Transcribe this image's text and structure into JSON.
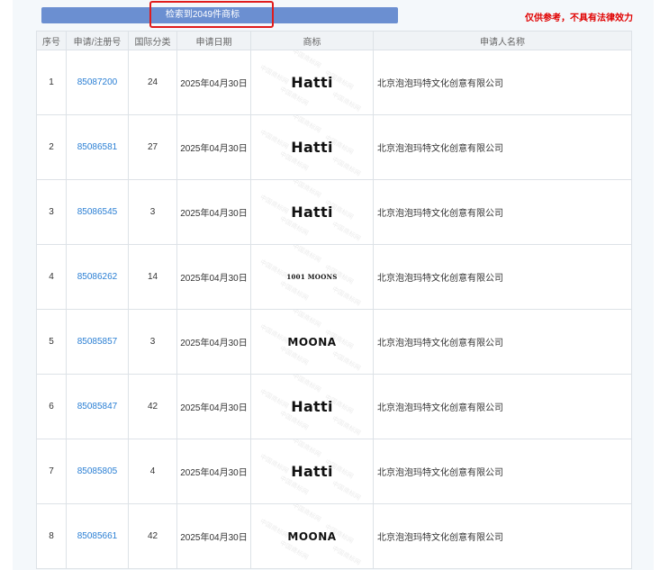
{
  "summary": {
    "text": "检索到2049件商标"
  },
  "disclaimer": "仅供参考，不具有法律效力",
  "watermark_text": "中国商标网",
  "columns": [
    "序号",
    "申请/注册号",
    "国际分类",
    "申请日期",
    "商标",
    "申请人名称"
  ],
  "rows": [
    {
      "index": "1",
      "reg_no": "85087200",
      "class": "24",
      "date": "2025年04月30日",
      "mark": "Hatti",
      "applicant": "北京泡泡玛特文化创意有限公司"
    },
    {
      "index": "2",
      "reg_no": "85086581",
      "class": "27",
      "date": "2025年04月30日",
      "mark": "Hatti",
      "applicant": "北京泡泡玛特文化创意有限公司"
    },
    {
      "index": "3",
      "reg_no": "85086545",
      "class": "3",
      "date": "2025年04月30日",
      "mark": "Hatti",
      "applicant": "北京泡泡玛特文化创意有限公司"
    },
    {
      "index": "4",
      "reg_no": "85086262",
      "class": "14",
      "date": "2025年04月30日",
      "mark": "1001 MOONS",
      "applicant": "北京泡泡玛特文化创意有限公司"
    },
    {
      "index": "5",
      "reg_no": "85085857",
      "class": "3",
      "date": "2025年04月30日",
      "mark": "MOONA",
      "applicant": "北京泡泡玛特文化创意有限公司"
    },
    {
      "index": "6",
      "reg_no": "85085847",
      "class": "42",
      "date": "2025年04月30日",
      "mark": "Hatti",
      "applicant": "北京泡泡玛特文化创意有限公司"
    },
    {
      "index": "7",
      "reg_no": "85085805",
      "class": "4",
      "date": "2025年04月30日",
      "mark": "Hatti",
      "applicant": "北京泡泡玛特文化创意有限公司"
    },
    {
      "index": "8",
      "reg_no": "85085661",
      "class": "42",
      "date": "2025年04月30日",
      "mark": "MOONA",
      "applicant": "北京泡泡玛特文化创意有限公司"
    }
  ]
}
